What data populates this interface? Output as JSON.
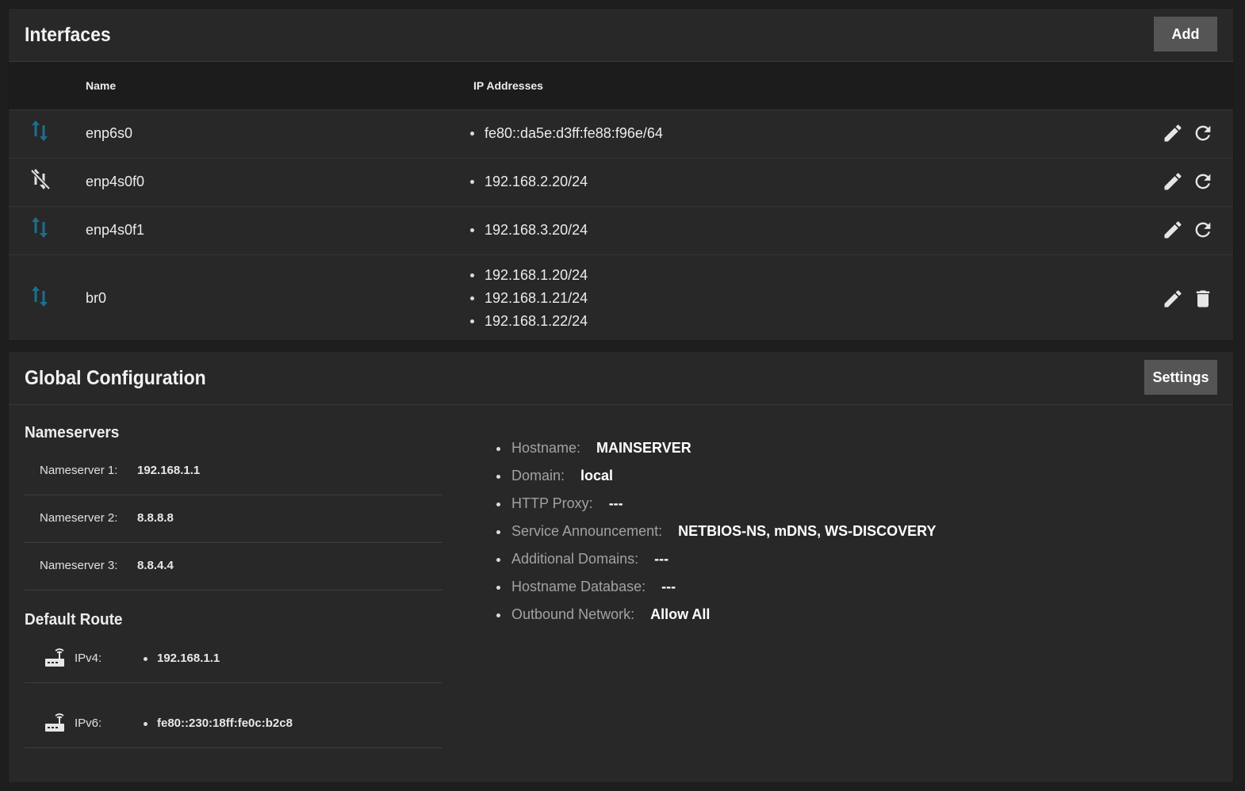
{
  "interfaces": {
    "title": "Interfaces",
    "add_label": "Add",
    "columns": {
      "name": "Name",
      "ips": "IP Addresses"
    },
    "rows": [
      {
        "status": "link-up",
        "name": "enp6s0",
        "ips": [
          "fe80::da5e:d3ff:fe88:f96e/64"
        ],
        "second_action": "refresh"
      },
      {
        "status": "link-down",
        "name": "enp4s0f0",
        "ips": [
          "192.168.2.20/24"
        ],
        "second_action": "refresh"
      },
      {
        "status": "link-up",
        "name": "enp4s0f1",
        "ips": [
          "192.168.3.20/24"
        ],
        "second_action": "refresh"
      },
      {
        "status": "link-up",
        "name": "br0",
        "ips": [
          "192.168.1.20/24",
          "192.168.1.21/24",
          "192.168.1.22/24"
        ],
        "second_action": "delete"
      }
    ],
    "colors": {
      "status_up": "#1e6e8f",
      "status_down": "#e0e0e0"
    }
  },
  "global": {
    "title": "Global Configuration",
    "settings_label": "Settings",
    "nameservers": {
      "title": "Nameservers",
      "items": [
        {
          "label": "Nameserver 1:",
          "value": "192.168.1.1"
        },
        {
          "label": "Nameserver 2:",
          "value": "8.8.8.8"
        },
        {
          "label": "Nameserver 3:",
          "value": "8.8.4.4"
        }
      ]
    },
    "default_route": {
      "title": "Default Route",
      "items": [
        {
          "icon": "router-icon",
          "label": "IPv4:",
          "value": "192.168.1.1"
        },
        {
          "icon": "router-icon",
          "label": "IPv6:",
          "value": "fe80::230:18ff:fe0c:b2c8"
        }
      ]
    },
    "info": [
      {
        "label": "Hostname:",
        "value": "MAINSERVER"
      },
      {
        "label": "Domain:",
        "value": "local"
      },
      {
        "label": "HTTP Proxy:",
        "value": "---"
      },
      {
        "label": "Service Announcement:",
        "value": "NETBIOS-NS, mDNS, WS-DISCOVERY"
      },
      {
        "label": "Additional Domains:",
        "value": "---"
      },
      {
        "label": "Hostname Database:",
        "value": "---"
      },
      {
        "label": "Outbound Network:",
        "value": "Allow All"
      }
    ]
  }
}
